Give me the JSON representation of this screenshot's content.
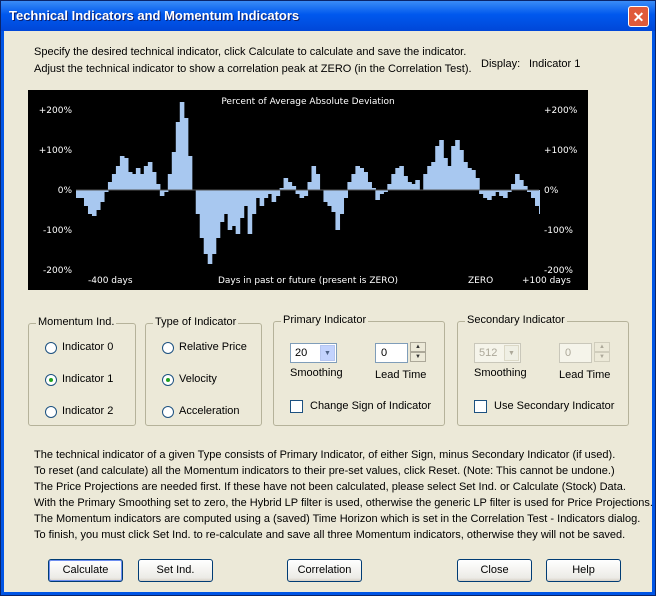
{
  "window": {
    "title": "Technical Indicators and Momentum Indicators",
    "close_glyph": "✕"
  },
  "intro": {
    "line1": "Specify the desired technical indicator, click Calculate to calculate and save the indicator.",
    "line2": "Adjust the technical indicator to show a correlation peak at ZERO (in the Correlation Test).",
    "display_label": "Display:",
    "display_value": "Indicator 1"
  },
  "chart_data": {
    "type": "area",
    "title": "Percent of Average Absolute Deviation",
    "xlabel": "Days in past or future (present is ZERO)",
    "ylabel": "",
    "x_tick_labels": [
      "-400 days",
      "ZERO",
      "+100 days"
    ],
    "y_tick_labels": [
      "+200%",
      "+100%",
      "0%",
      "-100%",
      "-200%"
    ],
    "ylim": [
      -200,
      200
    ],
    "x": [
      -460,
      -450,
      -445,
      -440,
      -435,
      -430,
      -425,
      -420,
      -415,
      -410,
      -405,
      -400,
      -395,
      -390,
      -385,
      -380,
      -375,
      -370,
      -365,
      -360,
      -355,
      -350,
      -345,
      -340,
      -335,
      -330,
      -325,
      -320,
      -315,
      -310,
      -305,
      -300,
      -295,
      -290,
      -285,
      -280,
      -275,
      -270,
      -265,
      -260,
      -255,
      -250,
      -245,
      -240,
      -235,
      -230,
      -225,
      -220,
      -215,
      -210,
      -205,
      -200,
      -195,
      -190,
      -185,
      -180,
      -175,
      -170,
      -165,
      -160,
      -155,
      -150,
      -145,
      -140,
      -135,
      -130,
      -125,
      -120,
      -115,
      -110,
      -105,
      -100,
      -95,
      -90,
      -85,
      -80,
      -75,
      -70,
      -65,
      -60,
      -55,
      -50,
      -45,
      -40,
      -35,
      -30,
      -25,
      -20,
      -15,
      -10,
      -5,
      0,
      5,
      10,
      15,
      20,
      25,
      30,
      35,
      40,
      45,
      50,
      55,
      60,
      65,
      70,
      75,
      80,
      85,
      90,
      95,
      100,
      105,
      110,
      115,
      120
    ],
    "values": [
      -20,
      -40,
      -60,
      -65,
      -50,
      -30,
      -5,
      20,
      40,
      60,
      85,
      80,
      45,
      40,
      55,
      40,
      60,
      70,
      45,
      15,
      -15,
      -5,
      40,
      95,
      170,
      220,
      180,
      85,
      0,
      -60,
      -120,
      -160,
      -185,
      -160,
      -120,
      -80,
      -60,
      -100,
      -90,
      -110,
      -70,
      -40,
      -110,
      -60,
      -20,
      -40,
      -20,
      -10,
      -30,
      -15,
      5,
      30,
      20,
      10,
      -10,
      -20,
      -15,
      20,
      60,
      40,
      0,
      -30,
      -40,
      -55,
      -100,
      -60,
      -20,
      20,
      40,
      60,
      55,
      45,
      20,
      5,
      -25,
      -10,
      -5,
      15,
      40,
      55,
      60,
      35,
      20,
      15,
      25,
      0,
      40,
      60,
      70,
      110,
      125,
      80,
      60,
      110,
      125,
      100,
      70,
      55,
      50,
      30,
      -10,
      -20,
      -25,
      -15,
      -5,
      -15,
      -20,
      -5,
      15,
      40,
      25,
      10,
      -5,
      -20,
      -40,
      -60
    ],
    "xlim": [
      -460,
      120
    ],
    "grid": false,
    "legend": "none",
    "fill_color": "#a8c8f0",
    "background": "#000000"
  },
  "groups": {
    "momentum": {
      "label": "Momentum Ind.",
      "options": [
        {
          "label": "Indicator 0",
          "selected": false
        },
        {
          "label": "Indicator 1",
          "selected": true
        },
        {
          "label": "Indicator 2",
          "selected": false
        }
      ]
    },
    "type": {
      "label": "Type of Indicator",
      "options": [
        {
          "label": "Relative Price",
          "selected": false
        },
        {
          "label": "Velocity",
          "selected": true
        },
        {
          "label": "Acceleration",
          "selected": false
        }
      ]
    },
    "primary": {
      "label": "Primary Indicator",
      "smoothing_value": "20",
      "smoothing_label": "Smoothing",
      "lead_value": "0",
      "lead_label": "Lead Time",
      "checkbox_label": "Change Sign of Indicator",
      "checked": false
    },
    "secondary": {
      "label": "Secondary Indicator",
      "smoothing_value": "512",
      "smoothing_label": "Smoothing",
      "lead_value": "0",
      "lead_label": "Lead Time",
      "checkbox_label": "Use Secondary Indicator",
      "checked": false,
      "enabled": false
    }
  },
  "description": [
    "The technical indicator of a given Type consists of Primary Indicator, of either Sign, minus Secondary Indicator (if used).",
    "To reset (and calculate) all the Momentum indicators to their pre-set values, click Reset.  (Note: This cannot be undone.)",
    "The Price Projections are needed first.  If these have not been calculated, please select Set Ind. or Calculate (Stock) Data.",
    "With the Primary Smoothing set to zero, the Hybrid LP filter is used, otherwise the generic LP filter is used for Price Projections.",
    "The Momentum indicators are computed using a (saved) Time Horizon which is set in the Correlation Test - Indicators dialog.",
    "To finish, you must click Set Ind. to re-calculate and save all three Momentum indicators, otherwise they will not be saved."
  ],
  "buttons": {
    "calculate": "Calculate",
    "set_ind": "Set Ind.",
    "correlation": "Correlation",
    "close": "Close",
    "help": "Help"
  },
  "icons": {
    "spin_up": "▲",
    "spin_down": "▼",
    "combo_arrow": "▼"
  }
}
